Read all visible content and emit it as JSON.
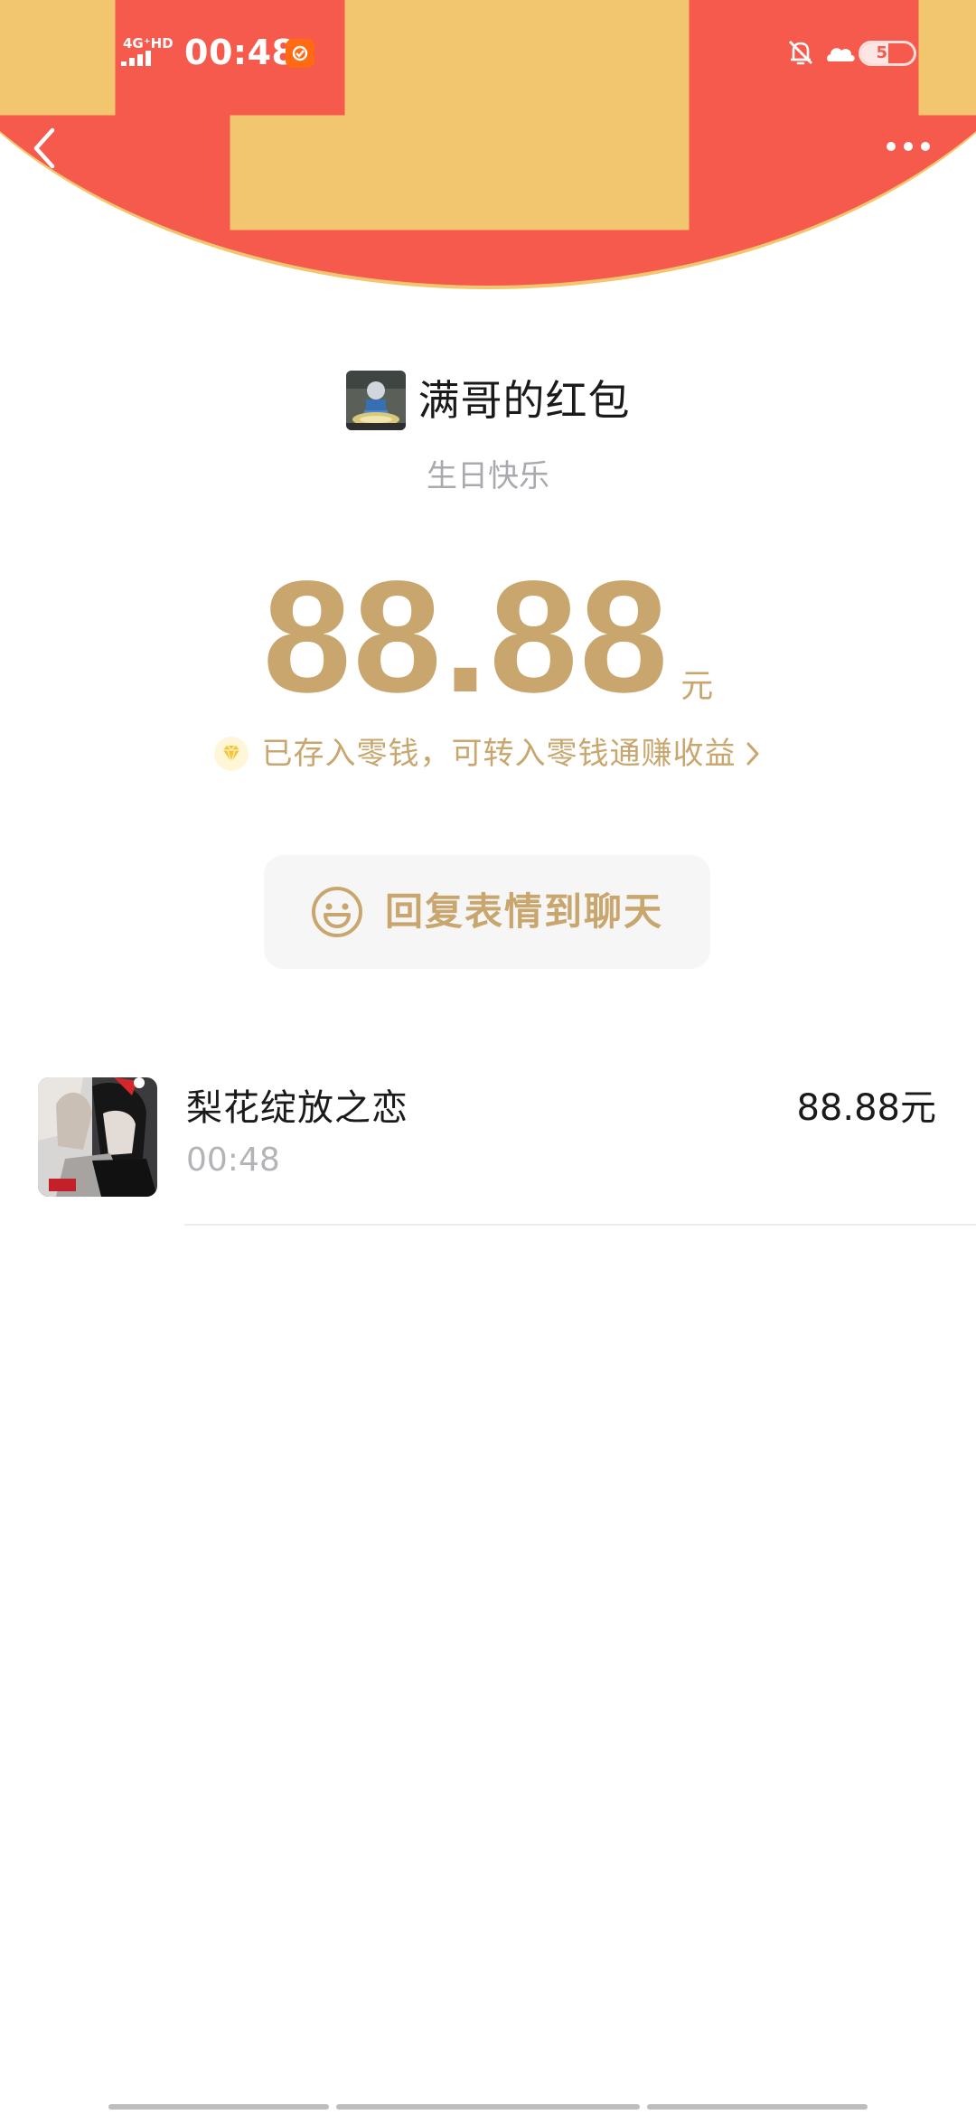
{
  "status_bar": {
    "network": "4G⁺HD",
    "time": "00:48",
    "battery_level": "51",
    "battery_fraction": 0.51
  },
  "nav": {
    "back_icon": "chevron-left-icon",
    "more_icon": "more-horizontal-icon"
  },
  "sender": {
    "title": "满哥的红包",
    "greeting": "生日快乐"
  },
  "amount": {
    "value": "88.88",
    "unit": "元"
  },
  "change_note": {
    "text": "已存入零钱，可转入零钱通赚收益",
    "icon": "diamond-icon"
  },
  "reply_button": {
    "label": "回复表情到聊天",
    "icon": "smile-icon"
  },
  "recipients": [
    {
      "name": "梨花绽放之恋",
      "time": "00:48",
      "amount": "88.88元"
    }
  ],
  "colors": {
    "header_red": "#f65a4c",
    "gold": "#c8a66d",
    "header_border": "#f2c66e"
  }
}
